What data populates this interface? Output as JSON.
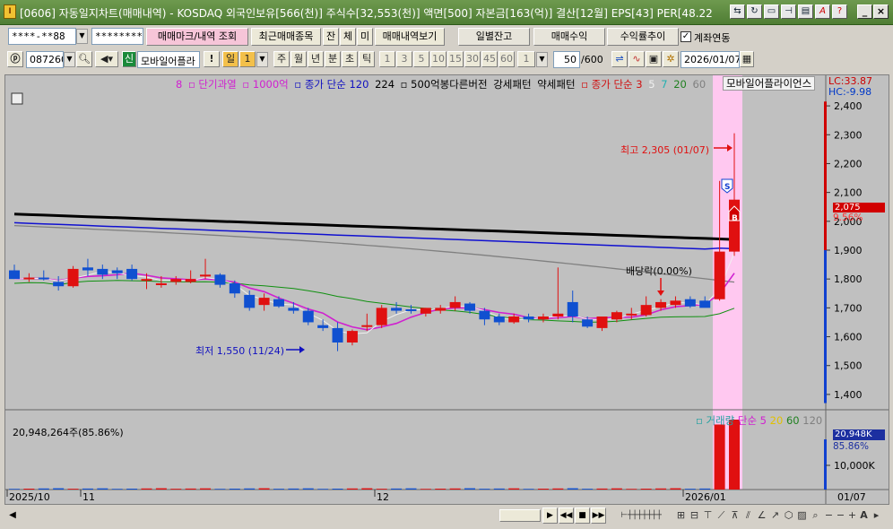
{
  "window": {
    "title": "[0606] 자동일지차트(매매내역) - KOSDAQ 외국인보유[566(천)] 주식수[32,553(천)] 액면[500] 자본금[163(억)] 결산[12월] EPS[43] PER[48.22",
    "app_icon": "I"
  },
  "toolbar1": {
    "account": "****-**88",
    "password": "********",
    "btn_trade_mark": "매매마크/내역 조회",
    "btn_recent": "최근매매종목",
    "btn_jan": "잔",
    "btn_che": "체",
    "btn_mi": "미",
    "btn_history": "매매내역보기",
    "btn_daily_balance": "일별잔고",
    "btn_trade_profit": "매매수익",
    "btn_return_trend": "수익률추이",
    "account_link_label": "계좌연동",
    "account_link_checked": "✓"
  },
  "toolbar2": {
    "code": "087260",
    "new_badge": "신",
    "stock_name": "모바일어플라",
    "exclaim": "!",
    "period_selected": "일",
    "period_num": "1",
    "periods": [
      "주",
      "월",
      "년",
      "분",
      "초",
      "틱"
    ],
    "intervals": [
      "1",
      "3",
      "5",
      "10",
      "15",
      "30",
      "45",
      "60"
    ],
    "interval_sel": "1",
    "count": "50",
    "count_max": "/600",
    "date": "2026/01/07"
  },
  "legend": {
    "items": [
      {
        "text": "8",
        "color": "#d020d0"
      },
      {
        "text": "▫ 단기과열",
        "color": "#d020d0"
      },
      {
        "text": "▫ 1000억",
        "color": "#d020d0"
      },
      {
        "text": "▫ 종가 단순 120",
        "color": "#1010c0"
      },
      {
        "text": "224",
        "color": "#000000"
      },
      {
        "text": "▫ 500억봉다른버전",
        "color": "#000000"
      },
      {
        "text": "강세패턴",
        "color": "#000000"
      },
      {
        "text": "약세패턴",
        "color": "#000000"
      },
      {
        "text": "▫ 종가 단순 3",
        "color": "#d01010"
      },
      {
        "text": "5",
        "color": "#f0f0f0"
      },
      {
        "text": "7",
        "color": "#20b0b0"
      },
      {
        "text": "20",
        "color": "#208020"
      },
      {
        "text": "60",
        "color": "#808080"
      }
    ],
    "stock_label": "모바일어플라이언스",
    "lc": "LC:33.87",
    "hc": "HC:-9.98"
  },
  "annotations": {
    "high": "최고 2,305 (01/07)",
    "low": "최저 1,550 (11/24)",
    "dividend": "배당락(0.00%)",
    "sell_mark": "S",
    "buy_mark": "B"
  },
  "price_axis": {
    "ticks": [
      "2,400",
      "2,300",
      "2,200",
      "2,100",
      "2,000",
      "1,900",
      "1,800",
      "1,700",
      "1,600",
      "1,500",
      "1,400"
    ],
    "current": "2,075",
    "change": "9.56%"
  },
  "volume": {
    "info": "20,948,264주(85.86%)",
    "legend_items": [
      {
        "text": "▫ 거래량",
        "color": "#20a0a0"
      },
      {
        "text": "단순 5",
        "color": "#d020d0"
      },
      {
        "text": "20",
        "color": "#e0c000"
      },
      {
        "text": "60",
        "color": "#208020"
      },
      {
        "text": "120",
        "color": "#808080"
      }
    ],
    "current": "20,948K",
    "pct": "85.86%",
    "tick": "10,000K"
  },
  "date_axis": {
    "labels": [
      "2025/10",
      "11",
      "12",
      "2026/01"
    ],
    "last": "01/07"
  },
  "colors": {
    "up": "#e01010",
    "down": "#1050d0",
    "ma224": "#000000",
    "ma120": "#1010d0",
    "ma60": "#808080",
    "ma20": "#109010",
    "highlight": "#ffc8f0"
  },
  "chart_data": {
    "type": "candlestick",
    "ylim": [
      1350,
      2450
    ],
    "candles": [
      {
        "o": 1830,
        "h": 1850,
        "l": 1800,
        "c": 1800
      },
      {
        "o": 1800,
        "h": 1820,
        "l": 1790,
        "c": 1805
      },
      {
        "o": 1805,
        "h": 1830,
        "l": 1795,
        "c": 1800
      },
      {
        "o": 1790,
        "h": 1810,
        "l": 1760,
        "c": 1775
      },
      {
        "o": 1775,
        "h": 1845,
        "l": 1770,
        "c": 1835
      },
      {
        "o": 1840,
        "h": 1870,
        "l": 1810,
        "c": 1830
      },
      {
        "o": 1835,
        "h": 1850,
        "l": 1800,
        "c": 1815
      },
      {
        "o": 1830,
        "h": 1840,
        "l": 1800,
        "c": 1820
      },
      {
        "o": 1835,
        "h": 1850,
        "l": 1795,
        "c": 1800
      },
      {
        "o": 1800,
        "h": 1820,
        "l": 1765,
        "c": 1800
      },
      {
        "o": 1780,
        "h": 1810,
        "l": 1770,
        "c": 1785
      },
      {
        "o": 1790,
        "h": 1810,
        "l": 1780,
        "c": 1800
      },
      {
        "o": 1790,
        "h": 1830,
        "l": 1785,
        "c": 1800
      },
      {
        "o": 1810,
        "h": 1870,
        "l": 1800,
        "c": 1815
      },
      {
        "o": 1815,
        "h": 1820,
        "l": 1770,
        "c": 1780
      },
      {
        "o": 1785,
        "h": 1795,
        "l": 1735,
        "c": 1750
      },
      {
        "o": 1745,
        "h": 1760,
        "l": 1690,
        "c": 1700
      },
      {
        "o": 1710,
        "h": 1750,
        "l": 1690,
        "c": 1735
      },
      {
        "o": 1730,
        "h": 1740,
        "l": 1700,
        "c": 1705
      },
      {
        "o": 1700,
        "h": 1720,
        "l": 1680,
        "c": 1690
      },
      {
        "o": 1690,
        "h": 1700,
        "l": 1640,
        "c": 1650
      },
      {
        "o": 1640,
        "h": 1660,
        "l": 1620,
        "c": 1630
      },
      {
        "o": 1630,
        "h": 1650,
        "l": 1550,
        "c": 1580
      },
      {
        "o": 1580,
        "h": 1625,
        "l": 1570,
        "c": 1620
      },
      {
        "o": 1640,
        "h": 1680,
        "l": 1620,
        "c": 1640
      },
      {
        "o": 1640,
        "h": 1710,
        "l": 1630,
        "c": 1700
      },
      {
        "o": 1700,
        "h": 1720,
        "l": 1680,
        "c": 1690
      },
      {
        "o": 1695,
        "h": 1710,
        "l": 1680,
        "c": 1690
      },
      {
        "o": 1680,
        "h": 1700,
        "l": 1670,
        "c": 1700
      },
      {
        "o": 1690,
        "h": 1710,
        "l": 1680,
        "c": 1700
      },
      {
        "o": 1700,
        "h": 1740,
        "l": 1690,
        "c": 1720
      },
      {
        "o": 1715,
        "h": 1720,
        "l": 1680,
        "c": 1690
      },
      {
        "o": 1690,
        "h": 1700,
        "l": 1640,
        "c": 1660
      },
      {
        "o": 1670,
        "h": 1680,
        "l": 1640,
        "c": 1650
      },
      {
        "o": 1650,
        "h": 1680,
        "l": 1645,
        "c": 1670
      },
      {
        "o": 1670,
        "h": 1680,
        "l": 1650,
        "c": 1660
      },
      {
        "o": 1660,
        "h": 1680,
        "l": 1650,
        "c": 1670
      },
      {
        "o": 1670,
        "h": 1840,
        "l": 1660,
        "c": 1680
      },
      {
        "o": 1720,
        "h": 1760,
        "l": 1650,
        "c": 1670
      },
      {
        "o": 1660,
        "h": 1670,
        "l": 1630,
        "c": 1635
      },
      {
        "o": 1630,
        "h": 1660,
        "l": 1620,
        "c": 1670
      },
      {
        "o": 1660,
        "h": 1690,
        "l": 1650,
        "c": 1685
      },
      {
        "o": 1680,
        "h": 1700,
        "l": 1660,
        "c": 1680
      },
      {
        "o": 1675,
        "h": 1740,
        "l": 1670,
        "c": 1710
      },
      {
        "o": 1700,
        "h": 1730,
        "l": 1690,
        "c": 1720
      },
      {
        "o": 1710,
        "h": 1740,
        "l": 1700,
        "c": 1725
      },
      {
        "o": 1730,
        "h": 1740,
        "l": 1700,
        "c": 1705
      },
      {
        "o": 1725,
        "h": 1740,
        "l": 1715,
        "c": 1700
      },
      {
        "o": 1730,
        "h": 2140,
        "l": 1725,
        "c": 1895
      },
      {
        "o": 1895,
        "h": 2305,
        "l": 1880,
        "c": 2075
      }
    ]
  }
}
